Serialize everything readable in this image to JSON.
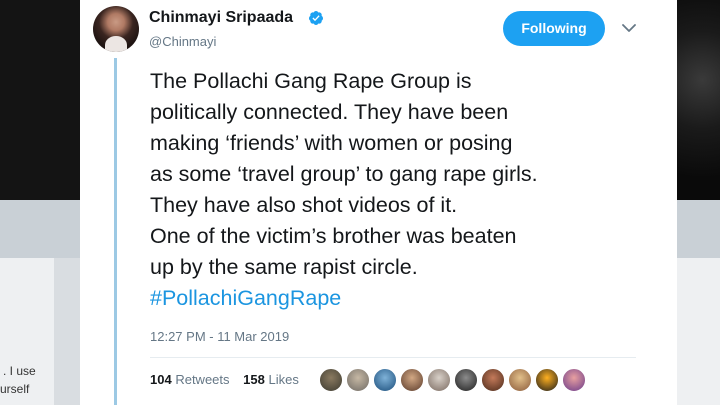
{
  "background": {
    "left_text_1": ". I use",
    "left_text_2": "urself"
  },
  "tweet": {
    "author_name": "Chinmayi Sripaada",
    "author_handle": "@Chinmayi",
    "follow_label": "Following",
    "body_lines": [
      "The Pollachi Gang Rape Group is",
      "politically connected. They have been",
      "making ‘friends’ with women or posing",
      "as some ‘travel group’ to gang rape girls.",
      "They have also shot videos of it.",
      "One of the victim’s brother was beaten",
      "up by the same rapist circle."
    ],
    "hashtag": "#PollachiGangRape",
    "timestamp": "12:27 PM - 11 Mar 2019",
    "retweets_count": "104",
    "retweets_label": "Retweets",
    "likes_count": "158",
    "likes_label": "Likes"
  },
  "colors": {
    "accent": "#1da1f2",
    "hashtag": "#1b95e0",
    "thread_line": "#9cc9e4",
    "secondary_text": "#657786"
  }
}
